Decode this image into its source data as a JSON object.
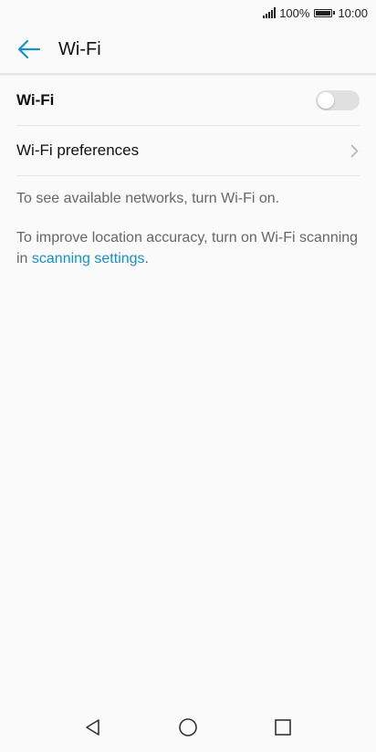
{
  "status_bar": {
    "battery_percent": "100%",
    "time": "10:00"
  },
  "header": {
    "title": "Wi-Fi",
    "back_icon": "arrow-left-icon",
    "accent_color": "#1592c8"
  },
  "wifi_row": {
    "label": "Wi-Fi",
    "toggle_on": false
  },
  "prefs_row": {
    "label": "Wi-Fi preferences",
    "icon": "chevron-right-icon"
  },
  "info": {
    "networks_text": "To see available networks, turn Wi-Fi on.",
    "location_text": "To improve location accuracy, turn on Wi-Fi scanning in ",
    "location_link": "scanning settings",
    "location_suffix": "."
  },
  "nav_bar": {
    "back_icon": "triangle-back-icon",
    "home_icon": "circle-home-icon",
    "recents_icon": "square-recents-icon"
  }
}
